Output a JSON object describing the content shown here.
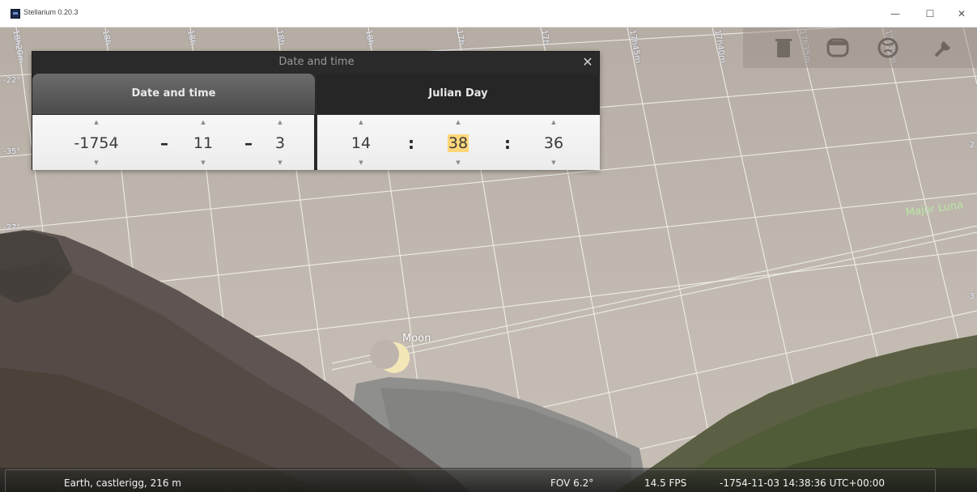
{
  "window": {
    "title": "Stellarium 0.20.3",
    "minimize_glyph": "—",
    "maximize_glyph": "☐",
    "close_glyph": "✕"
  },
  "sky": {
    "grid_labels_top": [
      "18h20m",
      "18h",
      "18h",
      "18h",
      "18h",
      "17h",
      "17h",
      "17h45m",
      "17h40m",
      "17h35m",
      "17h30m"
    ],
    "grid_labels_left": [
      "-22°",
      "-35°",
      "-27°"
    ],
    "grid_labels_right": [
      "-2",
      "-3"
    ],
    "major_lunar_label": "Major Luna",
    "moon_label": "Moon"
  },
  "toolbar": {
    "icons": [
      "trash-icon",
      "window-icon",
      "globe-icon",
      "wrench-icon"
    ]
  },
  "dialog": {
    "title": "Date and time",
    "close_glyph": "✕",
    "tabs": [
      {
        "label": "Date and time",
        "active": true
      },
      {
        "label": "Julian Day",
        "active": false
      }
    ],
    "date": {
      "year": "-1754",
      "month": "11",
      "day": "3",
      "separator": "–"
    },
    "time": {
      "hour": "14",
      "minute": "38",
      "second": "36",
      "separator": ":"
    },
    "arrow_up": "▲",
    "arrow_down": "▼"
  },
  "statusbar": {
    "location": "Earth, castlerigg, 216 m",
    "fov": "FOV 6.2°",
    "fps": "14.5 FPS",
    "datetime": "-1754-11-03 14:38:36 UTC+00:00"
  },
  "colors": {
    "sky": "#c0b8af",
    "grid_line": "#f2f0ec",
    "dialog_bg": "#2a2a2a",
    "highlight": "#ffd77a",
    "lunar_label": "#b9e6a6"
  }
}
